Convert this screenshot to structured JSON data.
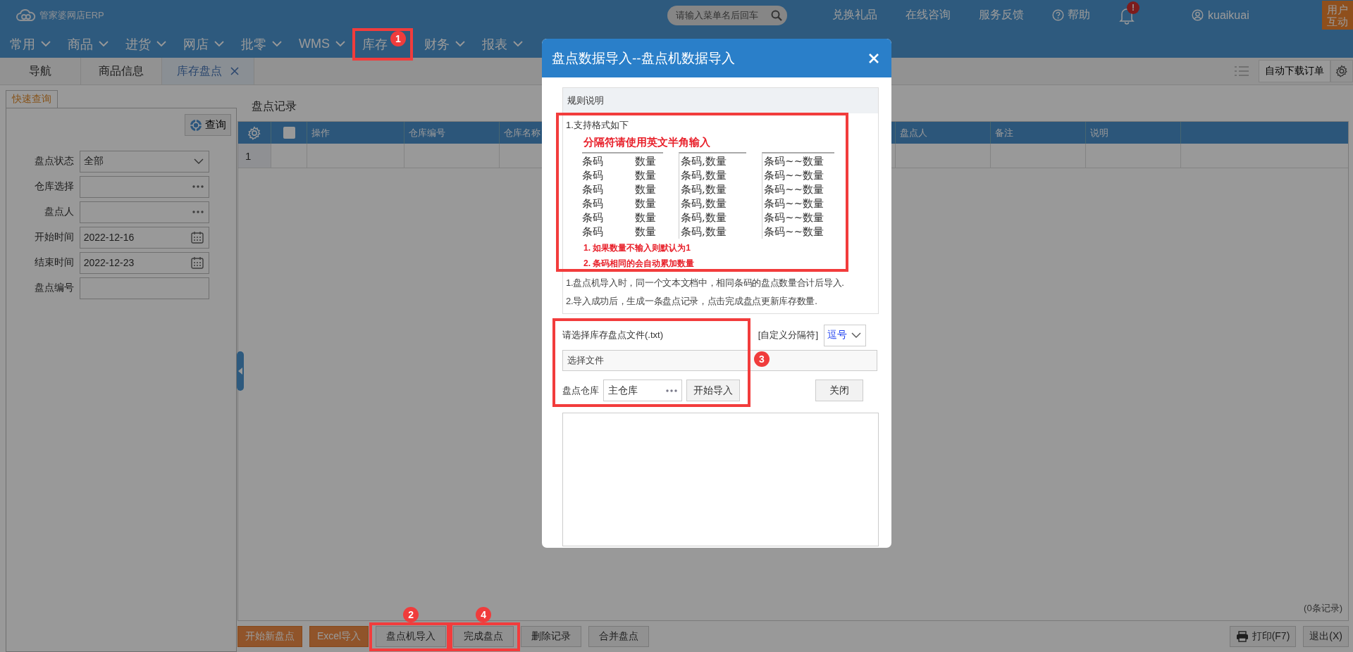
{
  "app": {
    "logo": "管家婆网店ERP",
    "search": {
      "placeholder": "请输入菜单名后回车"
    },
    "links": [
      {
        "label": "兑换礼品",
        "kind": "text"
      },
      {
        "label": "在线咨询",
        "kind": "text"
      },
      {
        "label": "服务反馈",
        "kind": "text"
      },
      {
        "label": "帮助",
        "kind": "help"
      }
    ],
    "notification_badge": "!",
    "user": "kuaikuai",
    "feedback_button": "用户互动"
  },
  "nav": [
    {
      "label": "常用",
      "caret": true
    },
    {
      "label": "商品",
      "caret": true
    },
    {
      "label": "进货",
      "caret": true
    },
    {
      "label": "网店",
      "caret": true
    },
    {
      "label": "批零",
      "caret": true
    },
    {
      "label": "WMS",
      "caret": true
    },
    {
      "label": "库存",
      "caret": false,
      "annotation": "1"
    },
    {
      "label": "财务",
      "caret": true
    },
    {
      "label": "报表",
      "caret": true
    }
  ],
  "tabs": [
    {
      "label": "导航",
      "selected": false,
      "closable": false
    },
    {
      "label": "商品信息",
      "selected": false,
      "closable": false
    },
    {
      "label": "库存盘点",
      "selected": true,
      "closable": true
    }
  ],
  "tab_actions": {
    "auto_download": "自动下载订单"
  },
  "query_panel": {
    "tab": "快速查询",
    "query_button": "查询",
    "fields": [
      {
        "label": "盘点状态",
        "kind": "select",
        "value": "全部"
      },
      {
        "label": "仓库选择",
        "kind": "lookup"
      },
      {
        "label": "盘点人",
        "kind": "lookup"
      },
      {
        "label": "开始时间",
        "kind": "date",
        "value": "2022-12-16"
      },
      {
        "label": "结束时间",
        "kind": "date",
        "value": "2022-12-23"
      },
      {
        "label": "盘点编号",
        "kind": "text"
      }
    ]
  },
  "records": {
    "title": "盘点记录",
    "select_all_checked": false,
    "columns": [
      "操作",
      "仓库编号",
      "仓库名称",
      "盘点人",
      "备注",
      "说明"
    ],
    "rows": [
      {
        "number": "1"
      }
    ],
    "count": "(0条记录)"
  },
  "toolbar": [
    {
      "label": "开始新盘点",
      "kind": "primary"
    },
    {
      "label": "Excel导入",
      "kind": "primary"
    },
    {
      "label": "盘点机导入",
      "kind": "normal",
      "annotation": "2"
    },
    {
      "label": "完成盘点",
      "kind": "normal",
      "annotation": "4"
    },
    {
      "label": "删除记录",
      "kind": "normal"
    },
    {
      "label": "合并盘点",
      "kind": "normal"
    }
  ],
  "toolbar_right": [
    {
      "label": "打印(F7)",
      "kind": "print"
    },
    {
      "label": "退出(X)",
      "kind": "plain"
    }
  ],
  "dialog": {
    "title": "盘点数据导入--盘点机数据导入",
    "rules": {
      "heading": "规则说明",
      "format_highlighted": true,
      "intro": "1.支持格式如下",
      "warning": "分隔符请使用英文半角输入",
      "columns": [
        {
          "kind": "spaced",
          "rows": [
            [
              "条码",
              "数量"
            ],
            [
              "条码",
              "数量"
            ],
            [
              "条码",
              "数量"
            ],
            [
              "条码",
              "数量"
            ],
            [
              "条码",
              "数量"
            ],
            [
              "条码",
              "数量"
            ]
          ]
        },
        {
          "kind": "joined",
          "rows": [
            "条码,数量",
            "条码,数量",
            "条码,数量",
            "条码,数量",
            "条码,数量",
            "条码,数量"
          ]
        },
        {
          "kind": "joined",
          "rows": [
            "条码~~数量",
            "条码~~数量",
            "条码~~数量",
            "条码~~数量",
            "条码~~数量",
            "条码~~数量"
          ]
        }
      ],
      "format_notes": [
        "1. 如果数量不输入则默认为1",
        "2. 条码相同的会自动累加数量"
      ],
      "notes": [
        "1.盘点机导入时，同一个文本文档中，相同条码的盘点数量合计后导入.",
        "2.导入成功后，生成一条盘点记录，点击完成盘点更新库存数量."
      ]
    },
    "file": {
      "label": "请选择库存盘点文件(.txt)",
      "separator_label": "[自定义分隔符]",
      "separator": "逗号",
      "file_button": "选择文件",
      "warehouse_label": "盘点仓库",
      "warehouse": "主仓库",
      "import_button": "开始导入",
      "close_button": "关闭",
      "annotation": "3"
    }
  }
}
